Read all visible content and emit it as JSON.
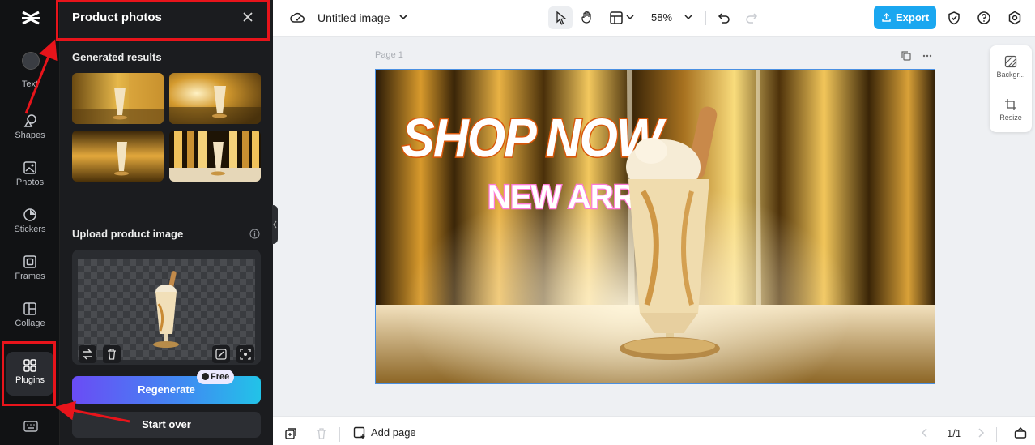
{
  "rail": {
    "items": [
      {
        "label": "Text"
      },
      {
        "label": "Shapes"
      },
      {
        "label": "Photos"
      },
      {
        "label": "Stickers"
      },
      {
        "label": "Frames"
      },
      {
        "label": "Collage"
      },
      {
        "label": "Plugins"
      }
    ]
  },
  "panel": {
    "title": "Product photos",
    "generated_label": "Generated results",
    "upload_label": "Upload product image",
    "regenerate_label": "Regenerate",
    "free_badge": "Free",
    "start_over_label": "Start over"
  },
  "topbar": {
    "doc_title": "Untitled image",
    "zoom": "58%",
    "export_label": "Export"
  },
  "canvas": {
    "page_label": "Page 1",
    "headline": "SHOP NOW",
    "subheadline": "NEW ARRIVAL"
  },
  "right_float": {
    "background_label": "Backgr...",
    "resize_label": "Resize"
  },
  "bottombar": {
    "add_page_label": "Add page",
    "page_count": "1/1"
  },
  "colors": {
    "accent": "#1aa7f0",
    "annotation": "#e8141b",
    "subheadline": "#ff7bd8"
  }
}
